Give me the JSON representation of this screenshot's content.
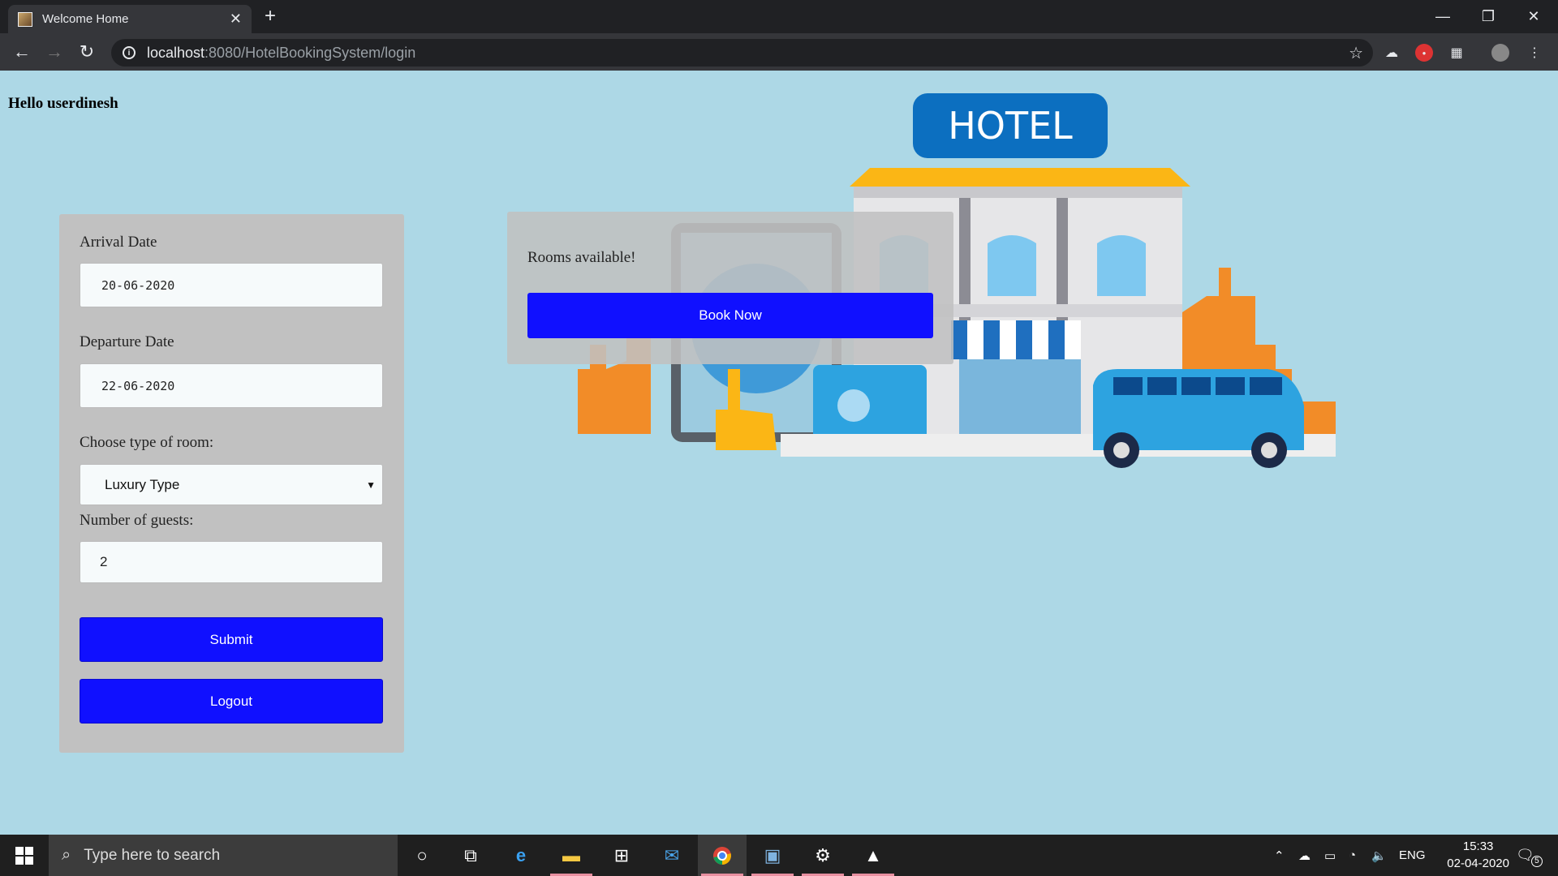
{
  "browser": {
    "tab_title": "Welcome Home",
    "url_host": "localhost",
    "url_path": ":8080/HotelBookingSystem/login"
  },
  "page": {
    "greeting": "Hello userdinesh",
    "form": {
      "arrival_label": "Arrival Date",
      "arrival_value": "20-06-2020",
      "departure_label": "Departure Date",
      "departure_value": "22-06-2020",
      "room_type_label": "Choose type of room:",
      "room_type_value": "Luxury Type",
      "guests_label": "Number of guests:",
      "guests_value": "2",
      "submit_label": "Submit",
      "logout_label": "Logout"
    },
    "availability": {
      "message": "Rooms available!",
      "book_label": "Book Now"
    },
    "hotel_sign": "HOTEL"
  },
  "taskbar": {
    "search_placeholder": "Type here to search",
    "language": "ENG",
    "time": "15:33",
    "date": "02-04-2020",
    "notification_count": "5"
  }
}
